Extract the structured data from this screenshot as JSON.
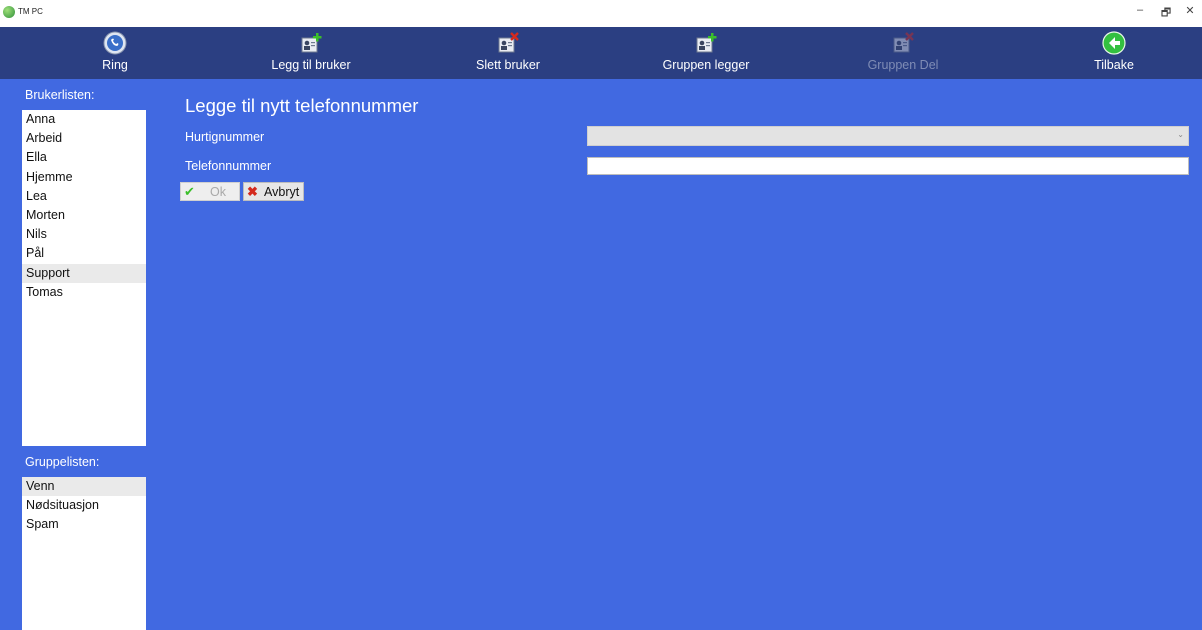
{
  "window": {
    "title": "TM PC",
    "controls": {
      "minimize": "–",
      "maximize": "🗗",
      "close": "✕"
    }
  },
  "toolbar": {
    "items": [
      {
        "label": "Ring",
        "icon": "phone-icon",
        "enabled": true
      },
      {
        "label": "Legg til bruker",
        "icon": "add-contact-icon",
        "enabled": true
      },
      {
        "label": "Slett bruker",
        "icon": "delete-contact-icon",
        "enabled": true
      },
      {
        "label": "Gruppen legger",
        "icon": "add-group-icon",
        "enabled": true
      },
      {
        "label": "Gruppen Del",
        "icon": "delete-group-icon",
        "enabled": false
      },
      {
        "label": "Tilbake",
        "icon": "back-arrow-icon",
        "enabled": true
      }
    ]
  },
  "sidebar": {
    "users_label": "Brukerlisten:",
    "users": [
      "Anna",
      "Arbeid",
      "Ella",
      "Hjemme",
      "Lea",
      "Morten",
      "Nils",
      "Pål",
      "Support",
      "Tomas"
    ],
    "users_selected": "Support",
    "groups_label": "Gruppelisten:",
    "groups": [
      "Venn",
      "Nødsituasjon",
      "Spam"
    ],
    "groups_selected": "Venn"
  },
  "form": {
    "title": "Legge til nytt telefonnummer",
    "speed_dial_label": "Hurtignummer",
    "speed_dial_value": "",
    "phone_label": "Telefonnummer",
    "phone_value": "",
    "ok_label": "Ok",
    "cancel_label": "Avbryt"
  },
  "colors": {
    "toolbar_bg": "#2b3f82",
    "main_bg": "#4169e1",
    "ok_check": "#3bbf2a",
    "cancel_x": "#d42a1e"
  }
}
